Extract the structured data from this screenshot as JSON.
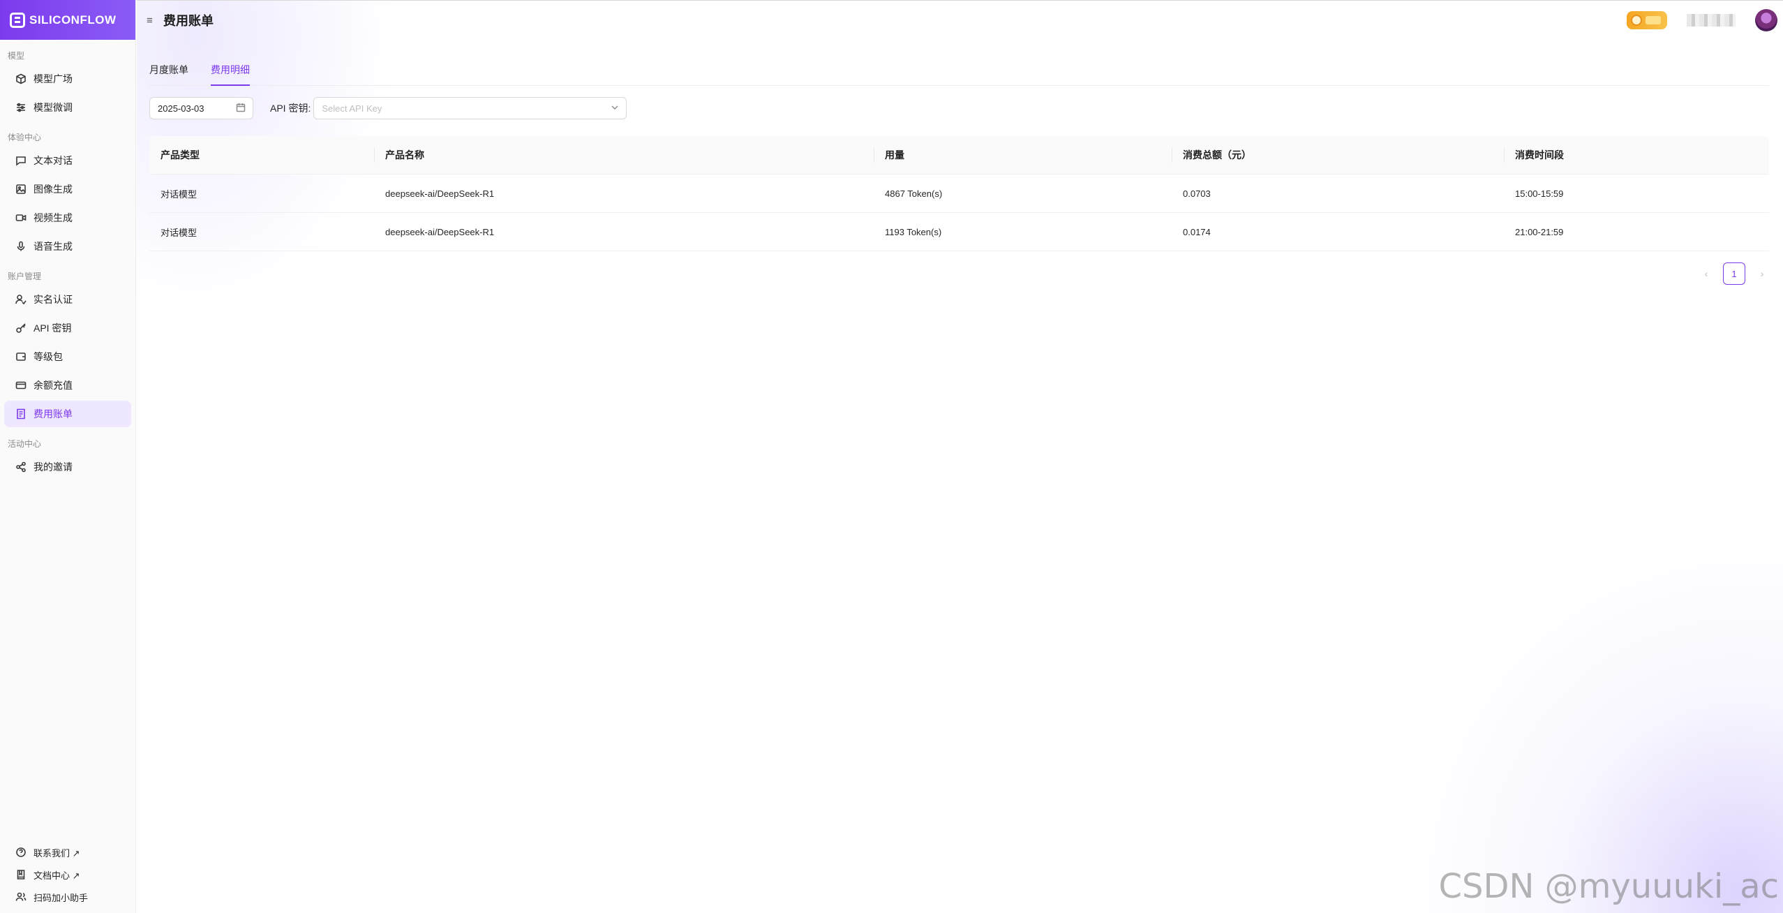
{
  "brand": {
    "name": "SILICONFLOW"
  },
  "sidebar": {
    "sections": [
      {
        "title": "模型",
        "items": [
          {
            "label": "模型广场",
            "icon": "cube-icon"
          },
          {
            "label": "模型微调",
            "icon": "sliders-icon"
          }
        ]
      },
      {
        "title": "体验中心",
        "items": [
          {
            "label": "文本对话",
            "icon": "chat-icon"
          },
          {
            "label": "图像生成",
            "icon": "image-icon"
          },
          {
            "label": "视频生成",
            "icon": "video-icon"
          },
          {
            "label": "语音生成",
            "icon": "mic-icon"
          }
        ]
      },
      {
        "title": "账户管理",
        "items": [
          {
            "label": "实名认证",
            "icon": "user-check-icon"
          },
          {
            "label": "API 密钥",
            "icon": "key-icon"
          },
          {
            "label": "等级包",
            "icon": "wallet-icon"
          },
          {
            "label": "余额充值",
            "icon": "credit-card-icon"
          },
          {
            "label": "费用账单",
            "icon": "bill-icon",
            "active": true
          }
        ]
      },
      {
        "title": "活动中心",
        "items": [
          {
            "label": "我的邀请",
            "icon": "share-icon"
          }
        ]
      }
    ],
    "bottom": [
      {
        "label": "联系我们 ↗",
        "icon": "help-circle-icon"
      },
      {
        "label": "文档中心 ↗",
        "icon": "book-icon"
      },
      {
        "label": "扫码加小助手",
        "icon": "users-icon"
      }
    ]
  },
  "header": {
    "title": "费用账单",
    "menu_icon": "≡"
  },
  "tabs": [
    {
      "label": "月度账单",
      "active": false
    },
    {
      "label": "费用明细",
      "active": true
    }
  ],
  "filters": {
    "date": "2025-03-03",
    "api_key_label": "API 密钥:",
    "api_key_placeholder": "Select API Key"
  },
  "table": {
    "columns": [
      "产品类型",
      "产品名称",
      "用量",
      "消费总额（元）",
      "消费时间段"
    ],
    "rows": [
      [
        "对话模型",
        "deepseek-ai/DeepSeek-R1",
        "4867 Token(s)",
        "0.0703",
        "15:00-15:59"
      ],
      [
        "对话模型",
        "deepseek-ai/DeepSeek-R1",
        "1193 Token(s)",
        "0.0174",
        "21:00-21:59"
      ]
    ]
  },
  "pagination": {
    "prev": "‹",
    "current": "1",
    "next": "›"
  },
  "watermark": "CSDN @myuuuki_ac",
  "colors": {
    "accent": "#7c3aed",
    "active_bg": "#efe6ff"
  }
}
